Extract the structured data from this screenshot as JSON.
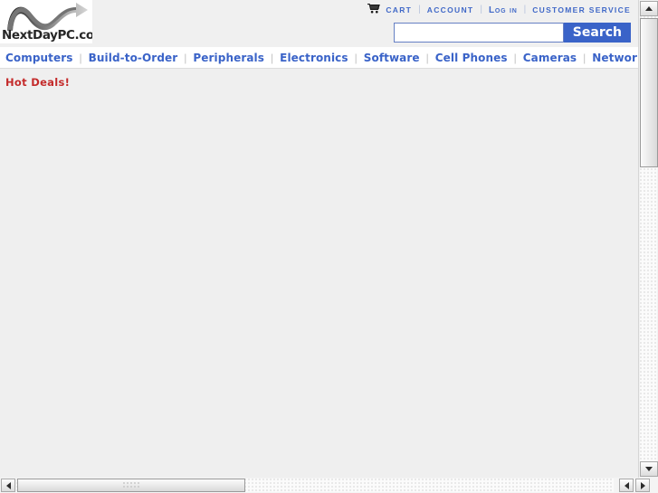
{
  "site": {
    "logo_text": "NextDayPC.com",
    "logo_icon": "wave-arrow-logo"
  },
  "utility_nav": {
    "cart_icon": "shopping-cart-icon",
    "items": [
      {
        "label": "CART",
        "style": "caps"
      },
      {
        "label": "ACCOUNT",
        "style": "caps"
      },
      {
        "label": "Log in",
        "style": "mixed"
      },
      {
        "label": "CUSTOMER SERVICE",
        "style": "caps"
      }
    ],
    "separator": "|"
  },
  "search": {
    "value": "",
    "placeholder": "",
    "button_label": "Search"
  },
  "main_nav": {
    "separator": "|",
    "items": [
      {
        "label": "Computers"
      },
      {
        "label": "Build-to-Order"
      },
      {
        "label": "Peripherals"
      },
      {
        "label": "Electronics"
      },
      {
        "label": "Software"
      },
      {
        "label": "Cell Phones"
      },
      {
        "label": "Cameras"
      },
      {
        "label": "Networking"
      }
    ]
  },
  "content": {
    "hot_deals_label": "Hot Deals!"
  },
  "colors": {
    "link_blue": "#3a63c8",
    "search_button_blue": "#3a63c8",
    "hot_deals_red": "#c42b2b",
    "page_background": "#efefef",
    "header_background": "#f0f0f0"
  },
  "scrollbars": {
    "vertical": {
      "up_arrow_icon": "scroll-up-arrow-icon",
      "down_arrow_icon": "scroll-down-arrow-icon"
    },
    "horizontal": {
      "left_arrow_icon": "scroll-left-arrow-icon",
      "right_arrow_icon": "scroll-right-arrow-icon"
    }
  }
}
